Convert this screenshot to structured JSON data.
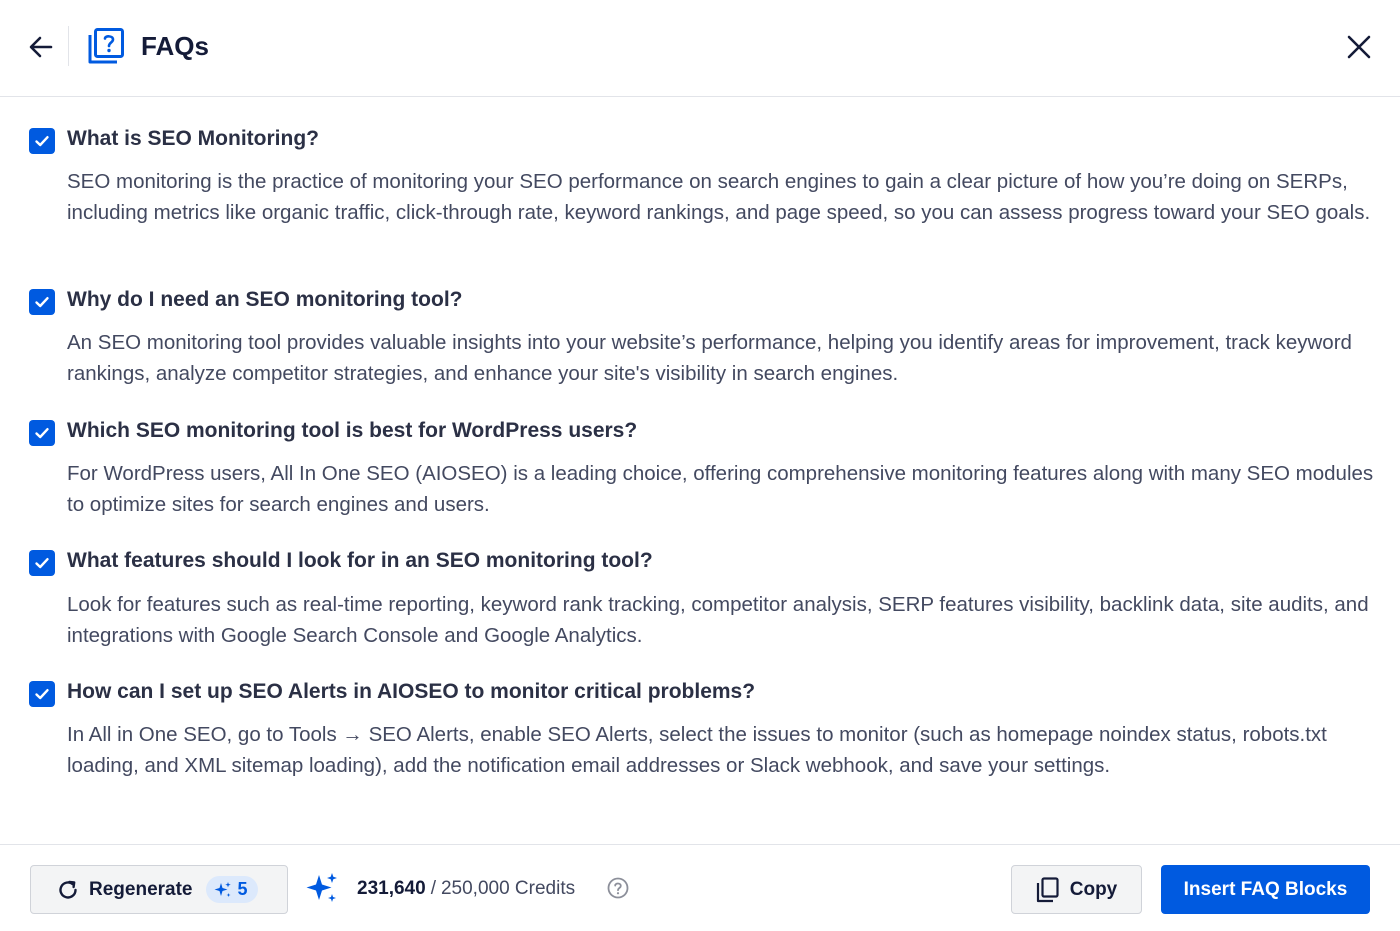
{
  "header": {
    "title": "FAQs"
  },
  "faqs": [
    {
      "question": "What is SEO Monitoring?",
      "answer": "SEO monitoring is the practice of monitoring your SEO performance on search engines to gain a clear picture of how you’re doing on SERPs, including metrics like organic traffic, click-through rate, keyword rankings, and page speed, so you can assess progress toward your SEO goals.",
      "checked": true
    },
    {
      "question": "Why do I need an SEO monitoring tool?",
      "answer": "An SEO monitoring tool provides valuable insights into your website’s performance, helping you identify areas for improvement, track keyword rankings, analyze competitor strategies, and enhance your site's visibility in search engines.",
      "checked": true
    },
    {
      "question": "Which SEO monitoring tool is best for WordPress users?",
      "answer": "For WordPress users, All In One SEO (AIOSEO) is a leading choice, offering comprehensive monitoring features along with many SEO modules to optimize sites for search engines and users.",
      "checked": true
    },
    {
      "question": "What features should I look for in an SEO monitoring tool?",
      "answer": "Look for features such as real-time reporting, keyword rank tracking, competitor analysis, SERP features visibility, backlink data, site audits, and integrations with Google Search Console and Google Analytics.",
      "checked": true
    },
    {
      "question": "How can I set up SEO Alerts in AIOSEO to monitor critical problems?",
      "answer": "In All in One SEO, go to Tools → SEO Alerts, enable SEO Alerts, select the issues to monitor (such as homepage noindex status, robots.txt loading, and XML sitemap loading), add the notification email addresses or Slack webhook, and save your settings.",
      "checked": true
    }
  ],
  "footer": {
    "regenerate_label": "Regenerate",
    "regenerate_cost": "5",
    "credits_used": "231,640",
    "credits_separator": "/",
    "credits_total": "250,000 Credits",
    "copy_label": "Copy",
    "insert_label": "Insert FAQ Blocks"
  },
  "colors": {
    "accent": "#005ae0",
    "text_primary": "#141b38",
    "text_secondary": "#434960",
    "border": "#e2e4e9"
  },
  "icons": {
    "back": "arrow-left-icon",
    "faq": "faq-question-icon",
    "close": "close-icon",
    "checkbox": "check-icon",
    "regenerate": "refresh-icon",
    "sparkle": "sparkle-icon",
    "help": "question-circle-icon",
    "copy": "copy-icon"
  }
}
